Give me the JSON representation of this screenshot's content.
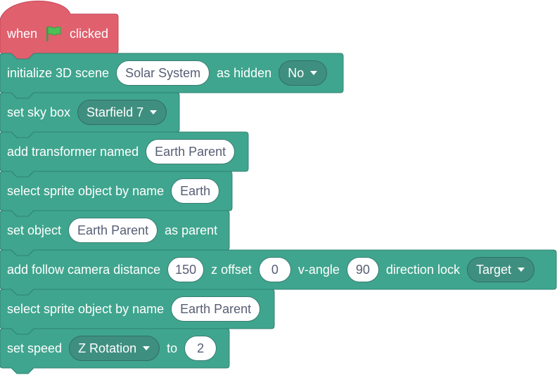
{
  "colors": {
    "event_block": "#e0606e",
    "event_block_edge": "#c5485a",
    "scene_block": "#3fa58e",
    "scene_block_edge": "#2f8271",
    "flag": "#4cbf56"
  },
  "hat": {
    "when_label": "when",
    "flag_icon": "green-flag-icon",
    "clicked_label": "clicked"
  },
  "blocks": {
    "init_scene": {
      "label": "initialize 3D scene",
      "name_value": "Solar System",
      "hidden_label": "as hidden",
      "hidden_value": "No"
    },
    "sky_box": {
      "label": "set sky box",
      "value": "Starfield 7"
    },
    "transformer": {
      "label": "add transformer named",
      "value": "Earth Parent"
    },
    "select_earth": {
      "label": "select sprite object by name",
      "value": "Earth"
    },
    "set_parent": {
      "label": "set object",
      "value": "Earth Parent",
      "suffix": "as parent"
    },
    "follow_cam": {
      "label": "add follow camera distance",
      "distance": "150",
      "z_label": "z offset",
      "z_value": "0",
      "v_label": "v-angle",
      "v_value": "90",
      "lock_label": "direction lock",
      "lock_value": "Target"
    },
    "select_parent": {
      "label": "select sprite object by name",
      "value": "Earth Parent"
    },
    "set_speed": {
      "label": "set speed",
      "axis_value": "Z Rotation",
      "to_label": "to",
      "speed_value": "2"
    }
  }
}
